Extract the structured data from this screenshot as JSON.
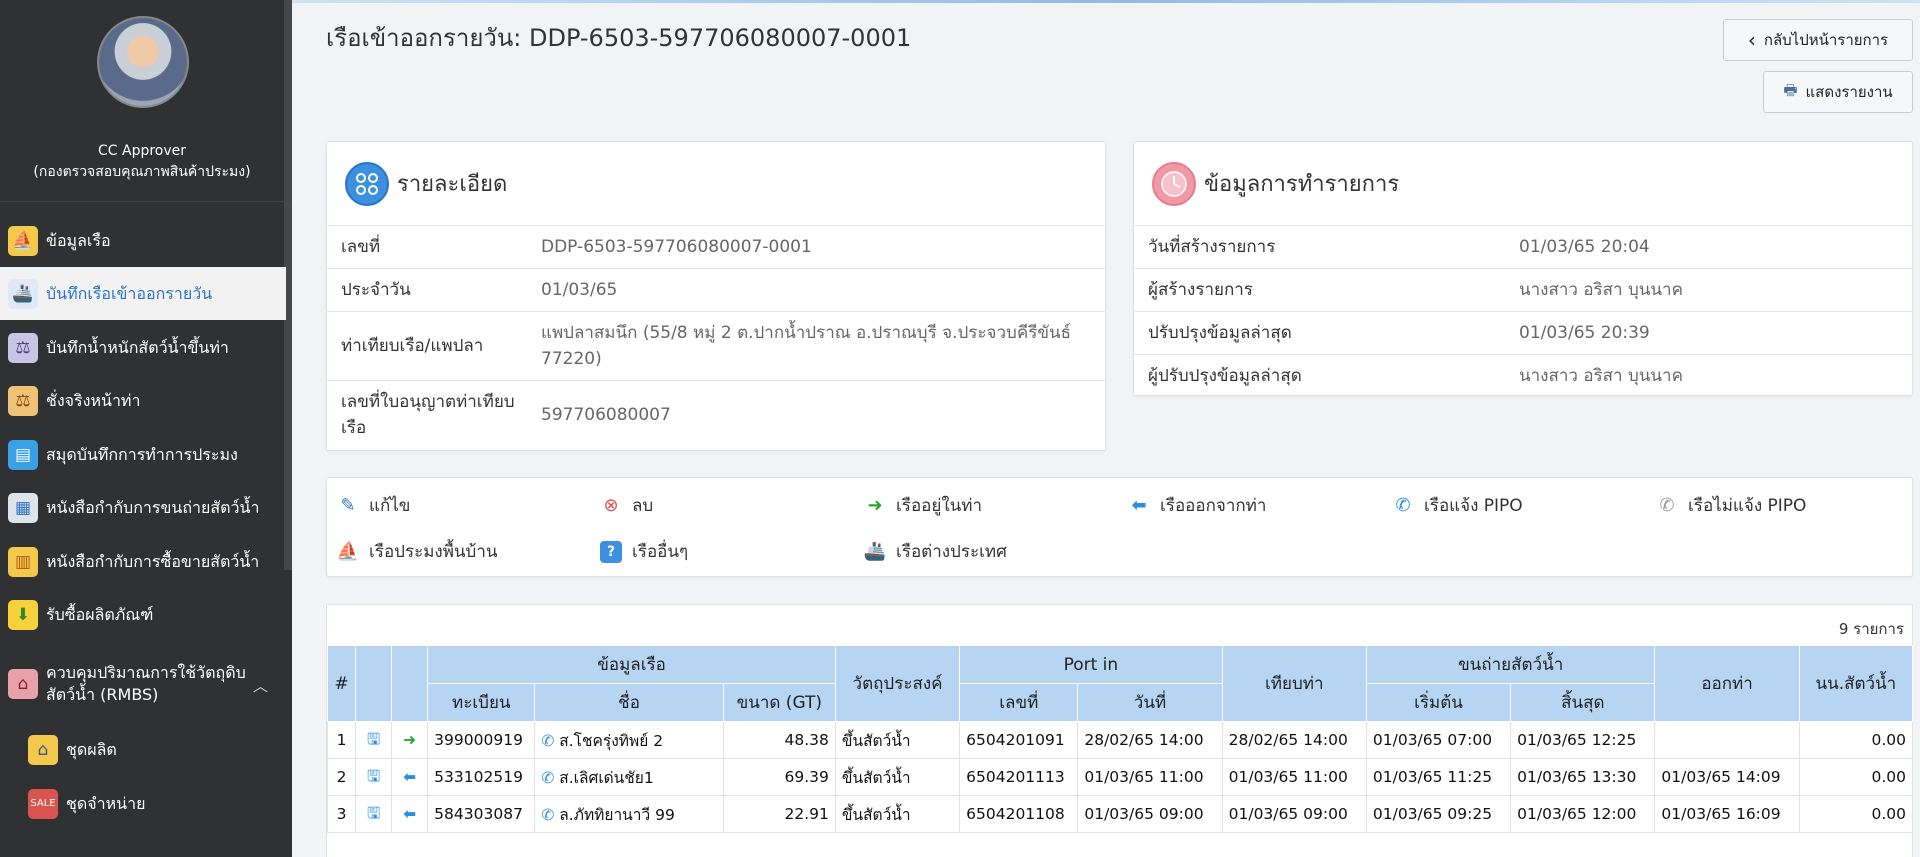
{
  "page": {
    "title": "เรือเข้าออกรายวัน: DDP-6503-597706080007-0001",
    "back_button": "กลับไปหน้ารายการ",
    "report_button": "แสดงรายงาน"
  },
  "profile": {
    "name": "CC Approver",
    "department": "(กองตรวจสอบคุณภาพสินค้าประมง)"
  },
  "sidebar": {
    "items": [
      {
        "label": "ข้อมูลเรือ",
        "icon": "boat-icon"
      },
      {
        "label": "บันทึกเรือเข้าออกรายวัน",
        "icon": "vessel-log-icon"
      },
      {
        "label": "บันทึกน้ำหนักสัตว์น้ำขึ้นท่า",
        "icon": "scale-icon"
      },
      {
        "label": "ชั่งจริงหน้าท่า",
        "icon": "weighing-icon"
      },
      {
        "label": "สมุดบันทึกการทำการประมง",
        "icon": "logbook-icon"
      },
      {
        "label": "หนังสือกำกับการขนถ่ายสัตว์น้ำ",
        "icon": "transfer-doc-icon"
      },
      {
        "label": "หนังสือกำกับการซื้อขายสัตว์น้ำ",
        "icon": "trade-doc-icon"
      },
      {
        "label": "รับซื้อผลิตภัณฑ์",
        "icon": "purchase-icon"
      },
      {
        "label": "ควบคุมปริมาณการใช้วัตถุดิบสัตว์น้ำ (RMBS)",
        "icon": "factory-icon"
      },
      {
        "label": "ชุดผลิต",
        "icon": "shop-icon"
      },
      {
        "label": "ชุดจำหน่าย",
        "icon": "sale-tag-icon"
      }
    ]
  },
  "details": {
    "heading": "รายละเอียด",
    "rows": [
      {
        "key": "เลขที่",
        "value": "DDP-6503-597706080007-0001"
      },
      {
        "key": "ประจำวัน",
        "value": "01/03/65"
      },
      {
        "key": "ท่าเทียบเรือ/แพปลา",
        "value": "แพปลาสมนึก (55/8 หมู่ 2 ต.ปากน้ำปราณ อ.ปราณบุรี จ.ประจวบคีรีขันธ์ 77220)"
      },
      {
        "key": "เลขที่ใบอนุญาตท่าเทียบเรือ",
        "value": "597706080007"
      }
    ]
  },
  "transaction": {
    "heading": "ข้อมูลการทำรายการ",
    "rows": [
      {
        "key": "วันที่สร้างรายการ",
        "value": "01/03/65 20:04"
      },
      {
        "key": "ผู้สร้างรายการ",
        "value": "นางสาว อริสา บุนนาค"
      },
      {
        "key": "ปรับปรุงข้อมูลล่าสุด",
        "value": "01/03/65 20:39"
      },
      {
        "key": "ผู้ปรับปรุงข้อมูลล่าสุด",
        "value": "นางสาว อริสา บุนนาค"
      }
    ]
  },
  "legend": {
    "edit": "แก้ไข",
    "delete": "ลบ",
    "in_port": "เรืออยู่ในท่า",
    "left_port": "เรือออกจากท่า",
    "pipo": "เรือแจ้ง PIPO",
    "no_pipo": "เรือไม่แจ้ง PIPO",
    "local_boat": "เรือประมงพื้นบ้าน",
    "other_boat": "เรืออื่นๆ",
    "foreign_boat": "เรือต่างประเทศ"
  },
  "table": {
    "count": "9 รายการ",
    "headers": {
      "hash": "#",
      "vessel_info": "ข้อมูลเรือ",
      "reg": "ทะเบียน",
      "name": "ชื่อ",
      "size": "ขนาด (GT)",
      "purpose": "วัตถุประสงค์",
      "port_in": "Port in",
      "port_no": "เลขที่",
      "port_date": "วันที่",
      "berth": "เทียบท่า",
      "transfer": "ขนถ่ายสัตว์น้ำ",
      "start": "เริ่มต้น",
      "end": "สิ้นสุด",
      "depart": "ออกท่า",
      "weight": "นน.สัตว์น้ำ"
    },
    "rows": [
      {
        "no": "1",
        "status": "in",
        "reg": "399000919",
        "name": "ส.โชครุ่งทิพย์ 2",
        "size": "48.38",
        "purpose": "ขึ้นสัตว์น้ำ",
        "port_no": "6504201091",
        "port_date": "28/02/65 14:00",
        "berth": "28/02/65 14:00",
        "start": "01/03/65 07:00",
        "end": "01/03/65 12:25",
        "depart": "",
        "weight": "0.00"
      },
      {
        "no": "2",
        "status": "out",
        "reg": "533102519",
        "name": "ส.เลิศเด่นชัย1",
        "size": "69.39",
        "purpose": "ขึ้นสัตว์น้ำ",
        "port_no": "6504201113",
        "port_date": "01/03/65 11:00",
        "berth": "01/03/65 11:00",
        "start": "01/03/65 11:25",
        "end": "01/03/65 13:30",
        "depart": "01/03/65 14:09",
        "weight": "0.00"
      },
      {
        "no": "3",
        "status": "out",
        "reg": "584303087",
        "name": "ล.ภัททิยานาวี 99",
        "size": "22.91",
        "purpose": "ขึ้นสัตว์น้ำ",
        "port_no": "6504201108",
        "port_date": "01/03/65 09:00",
        "berth": "01/03/65 09:00",
        "start": "01/03/65 09:25",
        "end": "01/03/65 12:00",
        "depart": "01/03/65 16:09",
        "weight": "0.00"
      }
    ]
  },
  "colors": {
    "sidebar_bg": "#2f3133",
    "active_text": "#2b74c7",
    "table_header": "#b5d5f3",
    "arrow_green": "#2aa52e",
    "arrow_blue": "#2b8fe0"
  }
}
